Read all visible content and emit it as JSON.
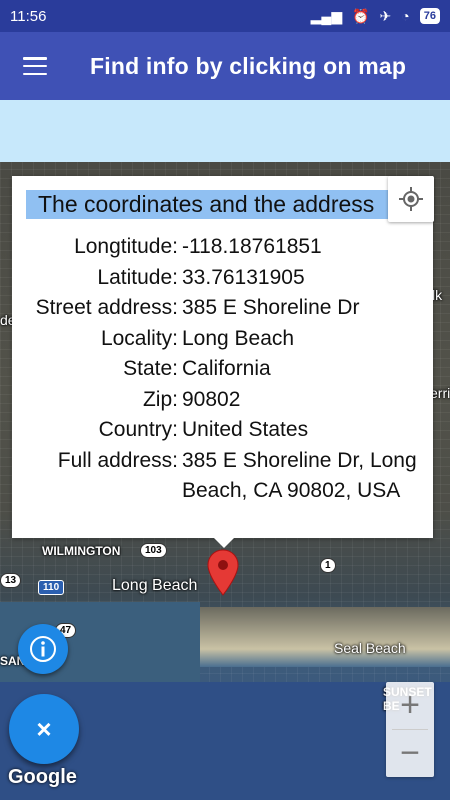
{
  "status_bar": {
    "time": "11:56",
    "battery": "76"
  },
  "app_bar": {
    "title": "Find info by clicking on map",
    "menu_icon": "hamburger-menu-icon"
  },
  "card": {
    "header": "The coordinates and the address",
    "rows": [
      {
        "label": "Longtitude:",
        "value": "-118.18761851"
      },
      {
        "label": "Latitude:",
        "value": "33.76131905"
      },
      {
        "label": "Street address:",
        "value": "385 E Shoreline Dr"
      },
      {
        "label": "Locality:",
        "value": "Long Beach"
      },
      {
        "label": "State:",
        "value": "California"
      },
      {
        "label": "Zip:",
        "value": "90802"
      },
      {
        "label": "Country:",
        "value": "United States"
      },
      {
        "label": "Full address:",
        "value": "385 E Shoreline Dr, Long Beach, CA 90802, USA"
      }
    ]
  },
  "map": {
    "labels": {
      "wilmington": "WILMINGTON",
      "long_beach": "Long Beach",
      "seal_beach": "Seal Beach",
      "sunset_beach": "SUNSET BE",
      "san": "SAN",
      "lk": "lk",
      "err": "errit",
      "de": "de"
    },
    "shields": {
      "r103": "103",
      "r110": "110",
      "r47": "47",
      "r1": "1",
      "r13": "13"
    },
    "attribution": "Google"
  },
  "controls": {
    "zoom_in": "+",
    "zoom_out": "−",
    "close": "×"
  }
}
